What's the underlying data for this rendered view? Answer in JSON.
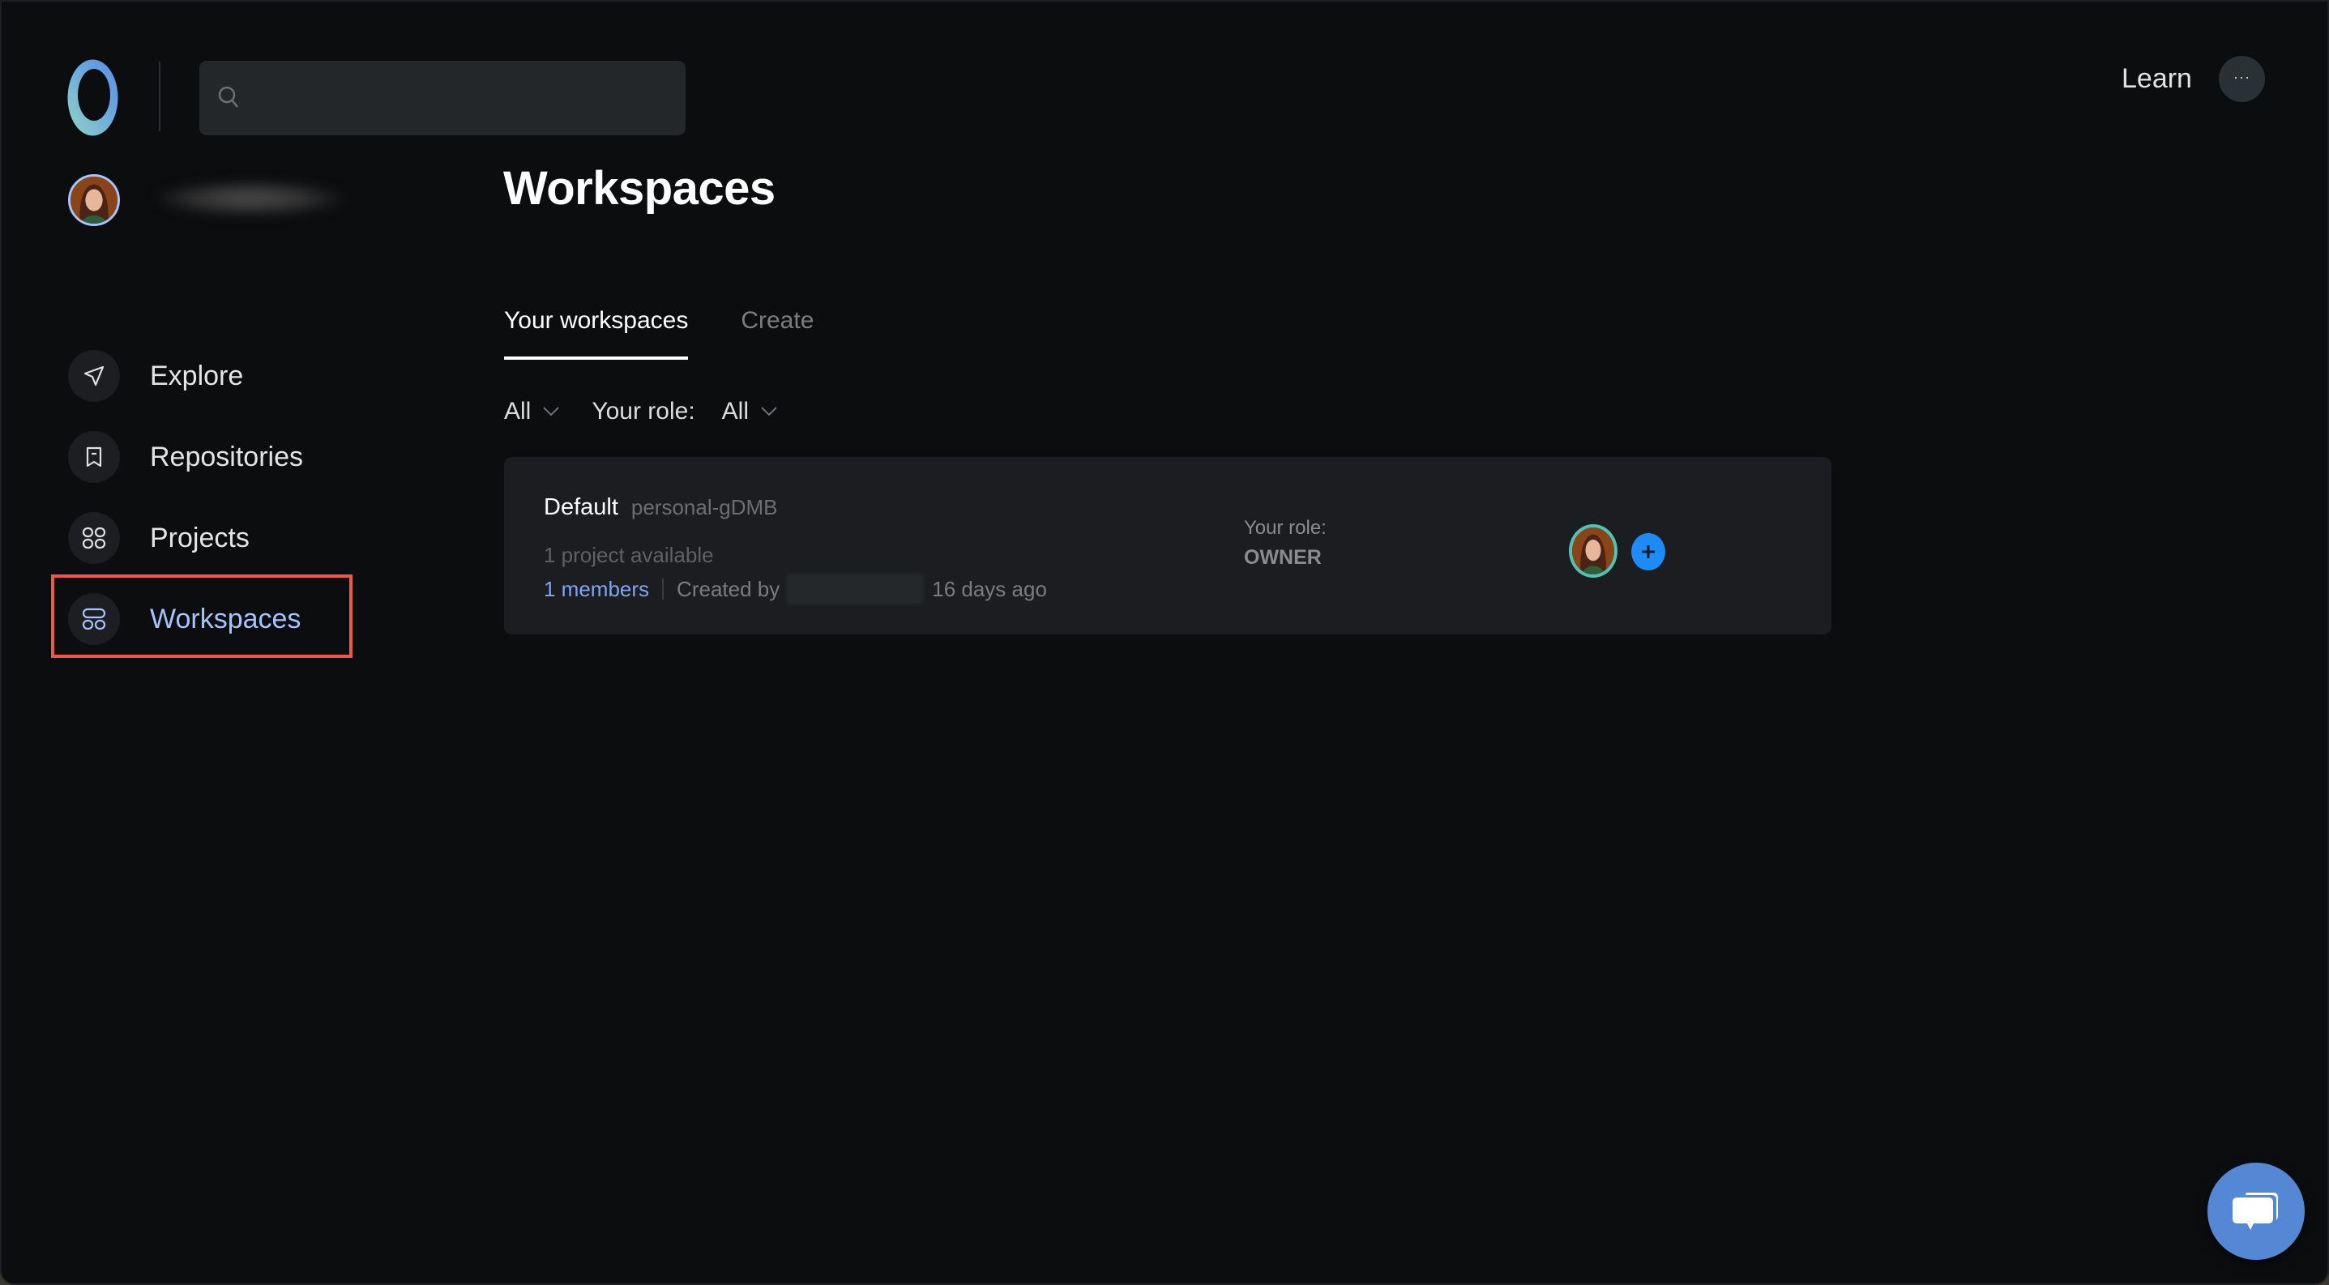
{
  "topbar": {
    "logo_icon": "ring-logo-icon",
    "search": {
      "placeholder": "",
      "value": "",
      "icon": "search-icon"
    },
    "learn_label": "Learn",
    "more_label": "···",
    "more_icon": "more-horizontal-icon"
  },
  "sidebar": {
    "user": {
      "name": "[blurred]",
      "avatar_icon": "user-avatar"
    },
    "items": [
      {
        "label": "Explore",
        "icon": "paper-plane-icon",
        "active": false
      },
      {
        "label": "Repositories",
        "icon": "bookmark-icon",
        "active": false
      },
      {
        "label": "Projects",
        "icon": "grid-four-icon",
        "active": false
      },
      {
        "label": "Workspaces",
        "icon": "workspaces-icon",
        "active": true
      }
    ],
    "highlight_color": "#f0574b",
    "active_color": "#a5c4ff"
  },
  "main": {
    "title": "Workspaces",
    "tabs": [
      {
        "label": "Your workspaces",
        "active": true
      },
      {
        "label": "Create",
        "active": false
      }
    ],
    "filters": {
      "type_value": "All",
      "role_label": "Your role:",
      "role_value": "All"
    },
    "workspaces": [
      {
        "name": "Default",
        "slug": "personal-gDMB",
        "projects": "1 project available",
        "members": "1 members",
        "created_by_label": "Created by",
        "created_by": "[blurred]",
        "created_ago": "16 days ago",
        "role_label": "Your role:",
        "role": "OWNER",
        "member_avatar_border": "#4fc4b6",
        "add_member_color": "#1d8cf8"
      }
    ]
  },
  "chat": {
    "icon": "chat-bubbles-icon",
    "color": "#5488d4"
  }
}
